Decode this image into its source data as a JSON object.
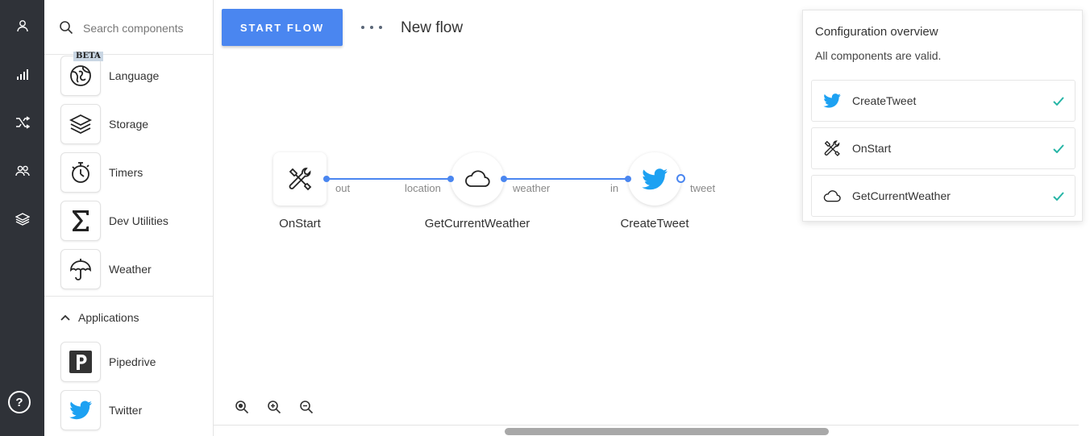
{
  "search": {
    "placeholder": "Search components"
  },
  "components": [
    {
      "label": "Language",
      "icon": "language-icon",
      "badge": "BETA"
    },
    {
      "label": "Storage",
      "icon": "layers-icon"
    },
    {
      "label": "Timers",
      "icon": "stopwatch-icon"
    },
    {
      "label": "Dev Utilities",
      "icon": "sigma-icon"
    },
    {
      "label": "Weather",
      "icon": "umbrella-icon"
    }
  ],
  "applications": {
    "label": "Applications",
    "items": [
      {
        "label": "Pipedrive",
        "icon": "pipedrive-icon"
      },
      {
        "label": "Twitter",
        "icon": "twitter-icon"
      }
    ]
  },
  "toolbar": {
    "start_label": "START FLOW",
    "flow_name": "New flow"
  },
  "flow": {
    "nodes": [
      {
        "label": "OnStart",
        "icon": "tools-icon",
        "out_port": "out"
      },
      {
        "label": "GetCurrentWeather",
        "icon": "cloud-icon",
        "in_port": "location",
        "out_port": "weather"
      },
      {
        "label": "CreateTweet",
        "icon": "twitter-icon",
        "in_port": "in",
        "out_port": "tweet"
      }
    ]
  },
  "config": {
    "title": "Configuration overview",
    "status": "All components are valid.",
    "items": [
      {
        "name": "CreateTweet",
        "icon": "twitter-icon",
        "valid": true
      },
      {
        "name": "OnStart",
        "icon": "tools-icon",
        "valid": true
      },
      {
        "name": "GetCurrentWeather",
        "icon": "cloud-icon",
        "valid": true
      }
    ]
  },
  "help": {
    "label": "?"
  },
  "colors": {
    "accent": "#4a86f0",
    "rail": "#2f3238",
    "twitter": "#1da1f2",
    "valid": "#26b5a6"
  }
}
